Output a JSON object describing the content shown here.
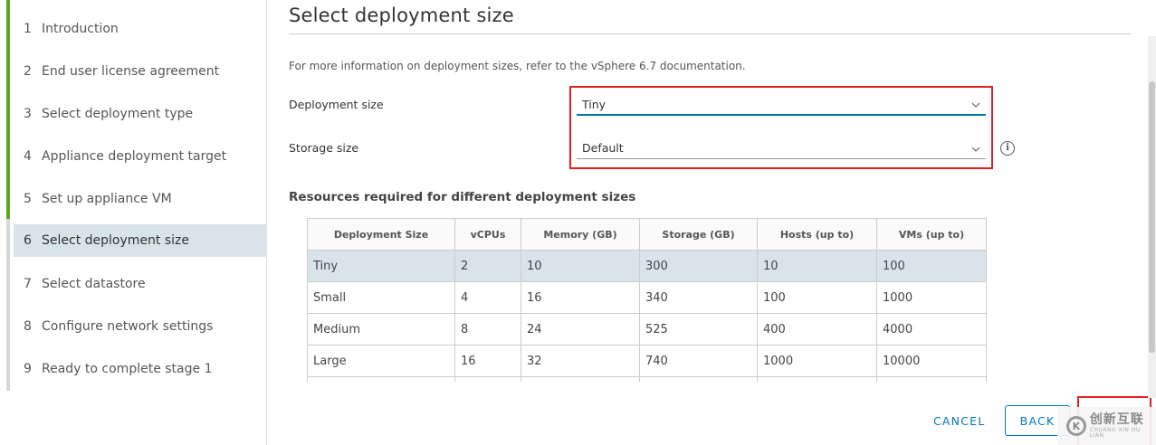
{
  "sidebar": {
    "steps": [
      {
        "num": "1",
        "label": "Introduction"
      },
      {
        "num": "2",
        "label": "End user license agreement"
      },
      {
        "num": "3",
        "label": "Select deployment type"
      },
      {
        "num": "4",
        "label": "Appliance deployment target"
      },
      {
        "num": "5",
        "label": "Set up appliance VM"
      },
      {
        "num": "6",
        "label": "Select deployment size"
      },
      {
        "num": "7",
        "label": "Select datastore"
      },
      {
        "num": "8",
        "label": "Configure network settings"
      },
      {
        "num": "9",
        "label": "Ready to complete stage 1"
      }
    ],
    "active_step": "6"
  },
  "main": {
    "title": "Select deployment size",
    "info_text": "For more information on deployment sizes, refer to the vSphere 6.7 documentation.",
    "deployment_size": {
      "label": "Deployment size",
      "value": "Tiny"
    },
    "storage_size": {
      "label": "Storage size",
      "value": "Default"
    },
    "resources_title": "Resources required for different deployment sizes",
    "table": {
      "headers": [
        "Deployment Size",
        "vCPUs",
        "Memory (GB)",
        "Storage (GB)",
        "Hosts (up to)",
        "VMs (up to)"
      ],
      "rows": [
        [
          "Tiny",
          "2",
          "10",
          "300",
          "10",
          "100"
        ],
        [
          "Small",
          "4",
          "16",
          "340",
          "100",
          "1000"
        ],
        [
          "Medium",
          "8",
          "24",
          "525",
          "400",
          "4000"
        ],
        [
          "Large",
          "16",
          "32",
          "740",
          "1000",
          "10000"
        ]
      ],
      "selected_row": "Tiny"
    }
  },
  "footer": {
    "cancel_label": "CANCEL",
    "back_label": "BACK"
  },
  "watermark": {
    "logo_glyph": "K",
    "text_cn": "创新互联",
    "text_en": "CHUANG XIN HU LIAN"
  },
  "icons": {
    "chevron": "chevron-down-icon",
    "info": "info-icon"
  },
  "colors": {
    "accent": "#0079b8",
    "progress_done": "#62a420",
    "highlight": "#e02020",
    "selected_row": "#d9e4ea"
  }
}
